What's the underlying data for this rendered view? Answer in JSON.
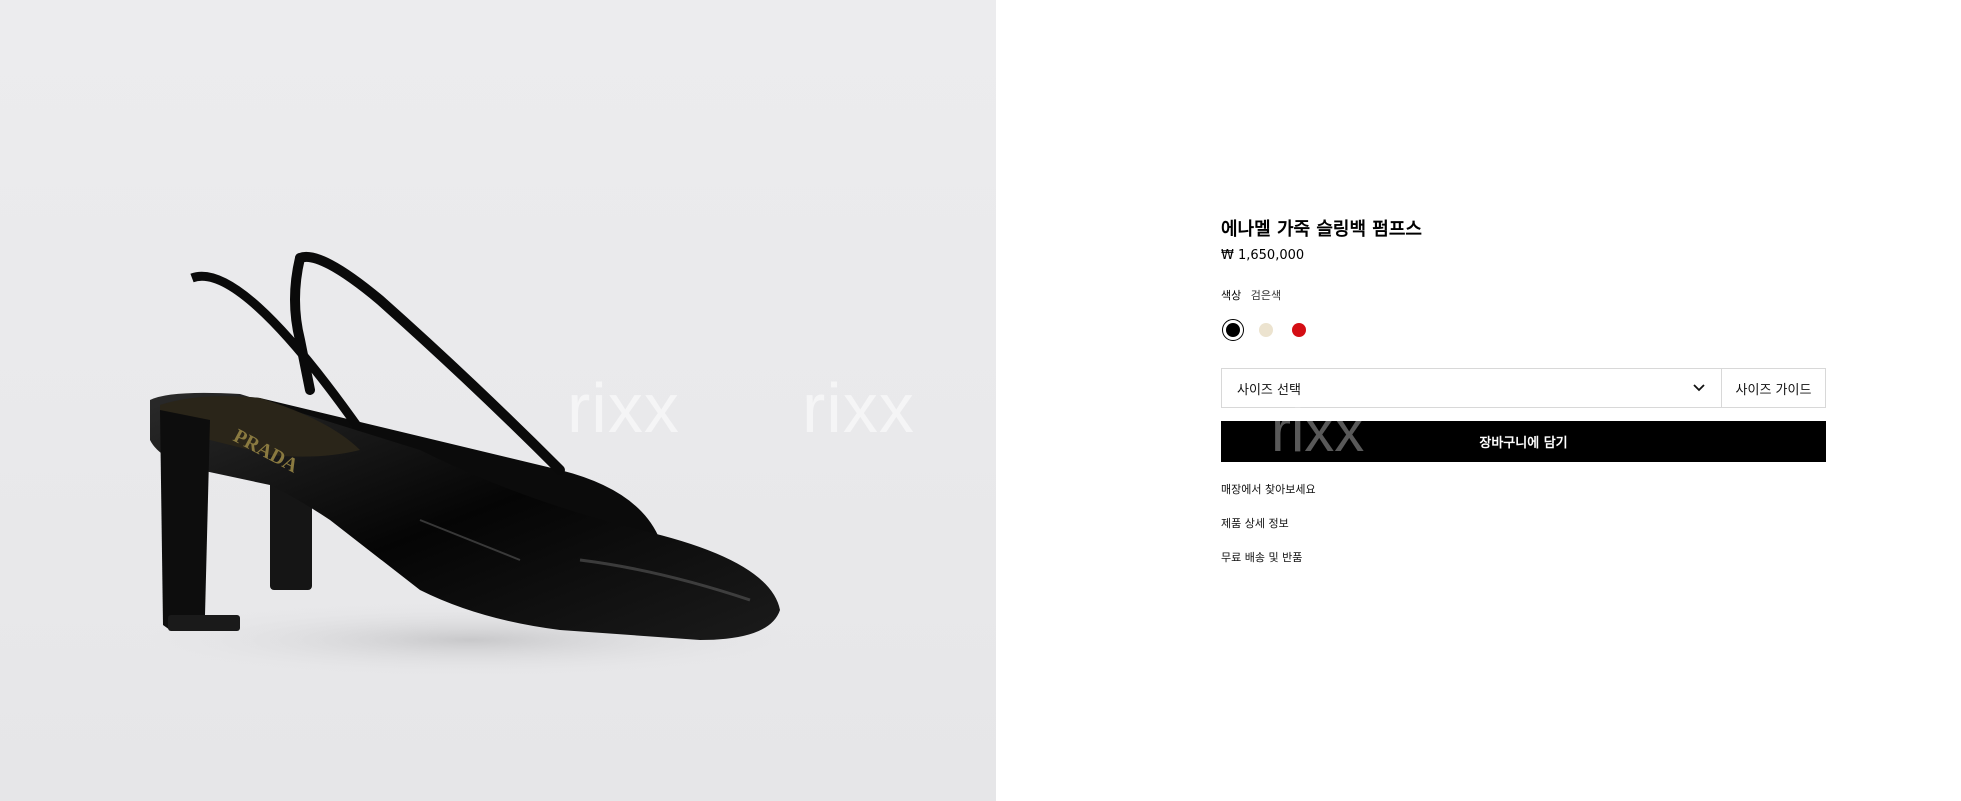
{
  "image": {
    "alt": "",
    "watermark_left": "rixx",
    "watermark_right": "rixx",
    "brand_on_insole": "PRADA"
  },
  "product": {
    "title": "에나멜 가죽 슬링백 펌프스",
    "price": "₩ 1,650,000",
    "color_label": "색상",
    "color_value": "검은색",
    "swatches": [
      {
        "name": "black",
        "color": "#000000",
        "selected": true
      },
      {
        "name": "ivory",
        "color": "#ece3cf",
        "selected": false
      },
      {
        "name": "red",
        "color": "#d40e14",
        "selected": false
      }
    ],
    "size_select": "사이즈 선택",
    "size_guide": "사이즈 가이드",
    "add_to_cart": "장바구니에 담기",
    "cart_watermark": "rixx",
    "links": [
      "매장에서 찾아보세요",
      "제품 상세 정보",
      "무료 배송 및 반품"
    ]
  }
}
